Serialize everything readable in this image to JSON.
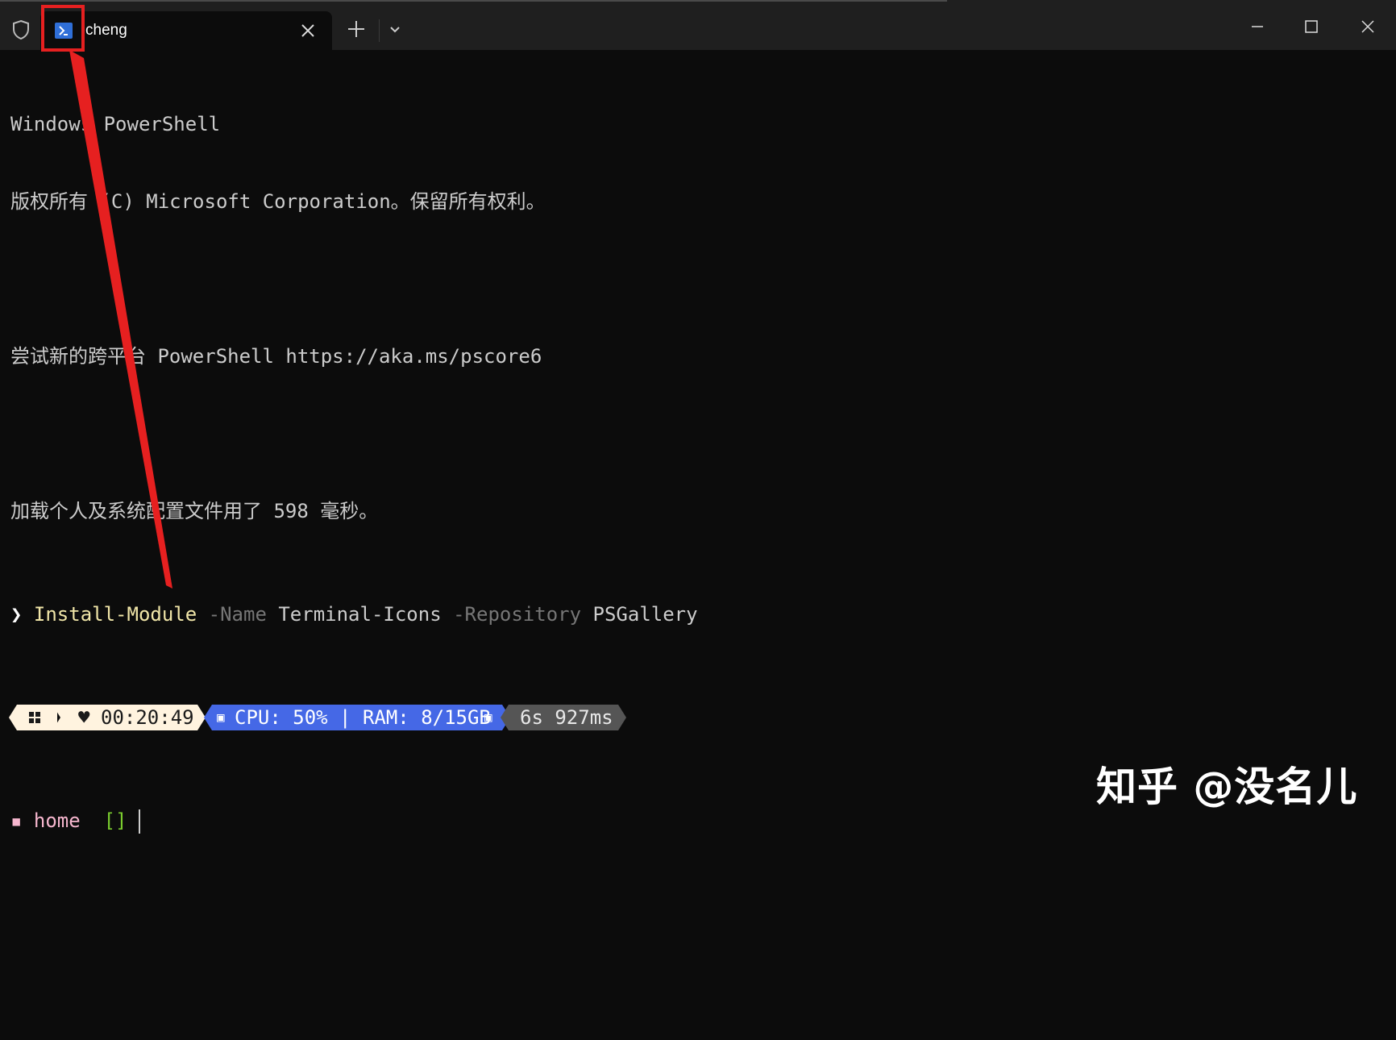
{
  "tab": {
    "title": "cheng",
    "icon": "powershell-icon"
  },
  "window_controls": [
    "minimize-icon",
    "maximize-icon",
    "close-icon"
  ],
  "terminal": {
    "line1": "Windows PowerShell",
    "line2": "版权所有 (C) Microsoft Corporation。保留所有权利。",
    "line3": "尝试新的跨平台 PowerShell https://aka.ms/pscore6",
    "line4": "加载个人及系统配置文件用了 598 毫秒。",
    "command": {
      "prompt": "❯",
      "name": "Install-Module",
      "param1": "-Name",
      "arg1": "Terminal-Icons",
      "param2": "-Repository",
      "arg2": "PSGallery"
    },
    "status": {
      "os_icon": "windows-icon",
      "time": "00:20:49",
      "sys": "CPU: 50% | RAM: 8/15GB",
      "duration": "6s 927ms"
    },
    "cwd": {
      "icon": "folder-icon",
      "name": "home",
      "bracket": "[]"
    }
  },
  "colors": {
    "accent": "#e62020",
    "system_segment": "#4568e6",
    "time_segment": "#fff3df"
  },
  "watermark": "知乎 @没名儿"
}
